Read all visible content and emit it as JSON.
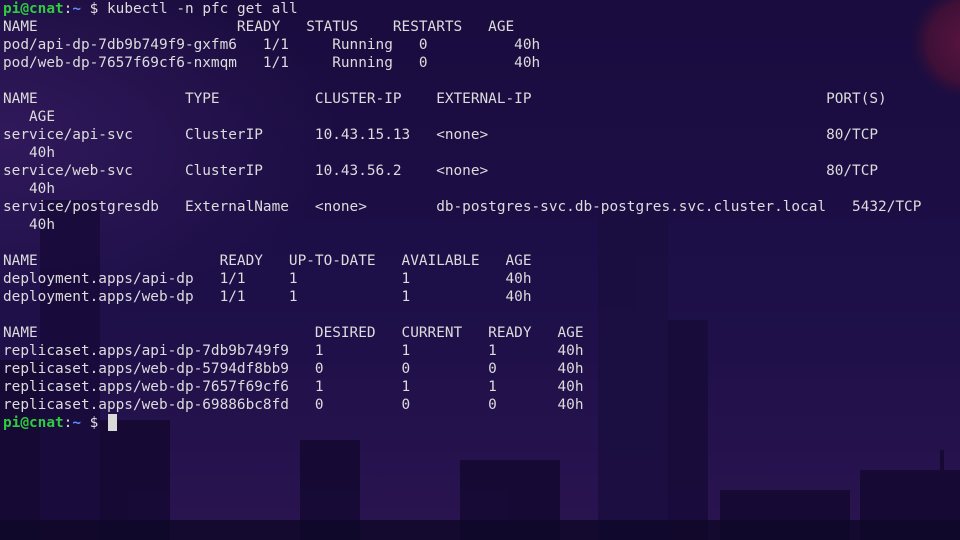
{
  "prompt": {
    "user_host": "pi@cnat",
    "colon": ":",
    "path": "~",
    "symbol": "$"
  },
  "command": "kubectl -n pfc get all",
  "pods": {
    "header": "NAME                       READY   STATUS    RESTARTS   AGE",
    "rows": [
      "pod/api-dp-7db9b749f9-gxfm6   1/1     Running   0          40h",
      "pod/web-dp-7657f69cf6-nxmqm   1/1     Running   0          40h"
    ]
  },
  "services": {
    "header": "NAME                 TYPE           CLUSTER-IP    EXTERNAL-IP                                  PORT(S)",
    "header_wrap": "   AGE",
    "rows": [
      {
        "line": "service/api-svc      ClusterIP      10.43.15.13   <none>                                       80/TCP",
        "wrap": "   40h"
      },
      {
        "line": "service/web-svc      ClusterIP      10.43.56.2    <none>                                       80/TCP",
        "wrap": "   40h"
      },
      {
        "line": "service/postgresdb   ExternalName   <none>        db-postgres-svc.db-postgres.svc.cluster.local   5432/TCP",
        "wrap": "   40h"
      }
    ]
  },
  "deployments": {
    "header": "NAME                     READY   UP-TO-DATE   AVAILABLE   AGE",
    "rows": [
      "deployment.apps/api-dp   1/1     1            1           40h",
      "deployment.apps/web-dp   1/1     1            1           40h"
    ]
  },
  "replicasets": {
    "header": "NAME                                DESIRED   CURRENT   READY   AGE",
    "rows": [
      "replicaset.apps/api-dp-7db9b749f9   1         1         1       40h",
      "replicaset.apps/web-dp-5794df8bb9   0         0         0       40h",
      "replicaset.apps/web-dp-7657f69cf6   1         1         1       40h",
      "replicaset.apps/web-dp-69886bc8fd   0         0         0       40h"
    ]
  }
}
